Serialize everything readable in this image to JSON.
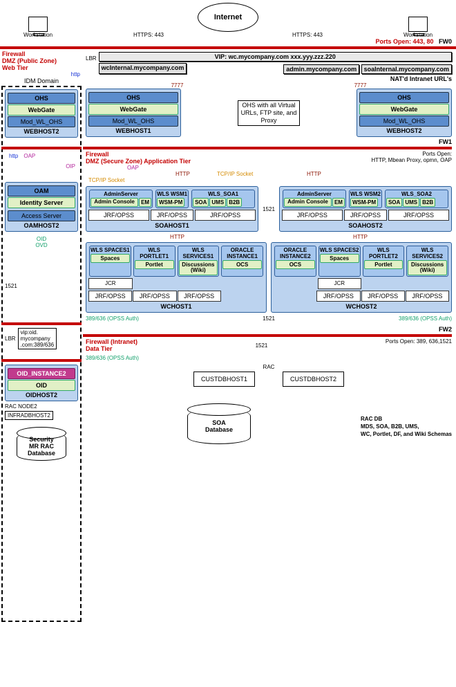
{
  "top": {
    "ws": "Workstation",
    "internet": "Internet",
    "https": "HTTPS: 443",
    "portsOpen": "Ports Open: 443, 80"
  },
  "fw": {
    "fw0": "FW0",
    "fw1": "FW1",
    "fw2": "FW2"
  },
  "webzone": {
    "title1": "Firewall",
    "title2": "DMZ (Public Zone)",
    "title3": "Web Tier",
    "lbr": "LBR",
    "vip": "VIP: wc.mycompany.com    xxx.yyy.zzz.220",
    "wcinternal": "wcInternal.mycompany.com",
    "admin": "admin.mycompany.com",
    "soainternal": "soaInternal.mycompany.com",
    "nat": "NAT'd Intranet URL's",
    "http": "http",
    "port7777": "7777",
    "ohsnote": "OHS with all Virtual URLs, FTP site, and Proxy"
  },
  "ohs": {
    "title": "OHS",
    "webgate": "WebGate",
    "modwl": "Mod_WL_OHS",
    "h1": "WEBHOST1",
    "h2": "WEBHOST2",
    "idm": "WEBHOST2"
  },
  "appzone": {
    "title1": "Firewall",
    "title2": "DMZ (Secure Zone) Application Tier",
    "ports": "Ports Open:\nHTTP, Mbean Proxy, opmn, OAP",
    "oap": "OAP",
    "oip": "OIP",
    "http": "HTTP",
    "tcp": "TCP/IP Socket",
    "http_lbl": "http",
    "p1521": "1521",
    "oid": "OID",
    "ovd": "OVD",
    "opss": "389/636 (OPSS Auth)"
  },
  "idm": {
    "domain": "IDM Domain",
    "oam": "OAM",
    "identity": "Identity Server",
    "access": "Access Server",
    "oamhost": "OAMHOST2",
    "lbr": "LBR",
    "viplbr": "vip:oid.\nmycompany\n.com:389/636",
    "oidinst": "OID_INSTANCE2",
    "oid": "OID",
    "oidhost": "OIDHOST2",
    "rac": "RAC NODE2",
    "infra": "INFRADBHOST2",
    "secdb": "Security\nMR RAC\nDatabase"
  },
  "soa": {
    "admin": "AdminServer",
    "adminconsole": "Admin Console",
    "em": "EM",
    "wsm1": "WLS WSM1",
    "wsm2": "WLS WSM2",
    "wsmpm": "WSM-PM",
    "wlssoa1": "WLS_SOA1",
    "wlssoa2": "WLS_SOA2",
    "soa": "SOA",
    "ums": "UMS",
    "b2b": "B2B",
    "jrf": "JRF/OPSS",
    "h1": "SOAHOST1",
    "h2": "SOAHOST2",
    "p1521": "1521",
    "http": "HTTP"
  },
  "wc": {
    "spaces1": "WLS SPACES1",
    "portlet1": "WLS PORTLET1",
    "services1": "WLS SERVICES1",
    "inst1": "ORACLE INSTANCE1",
    "spaces2": "WLS SPACES2",
    "portlet2": "WLS PORTLET2",
    "services2": "WLS SERVICES2",
    "inst2": "ORACLE INSTANCE2",
    "spaces": "Spaces",
    "portlet": "Portlet",
    "disc": "Discussions (Wiki)",
    "ocs": "OCS",
    "jcr": "JCR",
    "jrf": "JRF/OPSS",
    "h1": "WCHOST1",
    "h2": "WCHOST2",
    "p1521": "1521"
  },
  "datazone": {
    "title1": "Firewall  (Intranet)",
    "title2": "Data Tier",
    "ports": "Ports Open: 389, 636,1521",
    "p1521": "1521",
    "rac": "RAC",
    "cust1": "CUSTDBHOST1",
    "cust2": "CUSTDBHOST2",
    "soadb": "SOA\nDatabase",
    "racdb": "RAC DB\nMDS, SOA, B2B, UMS,\nWC, Portlet, DF, and Wiki Schemas",
    "opss": "389/636 (OPSS Auth)"
  }
}
